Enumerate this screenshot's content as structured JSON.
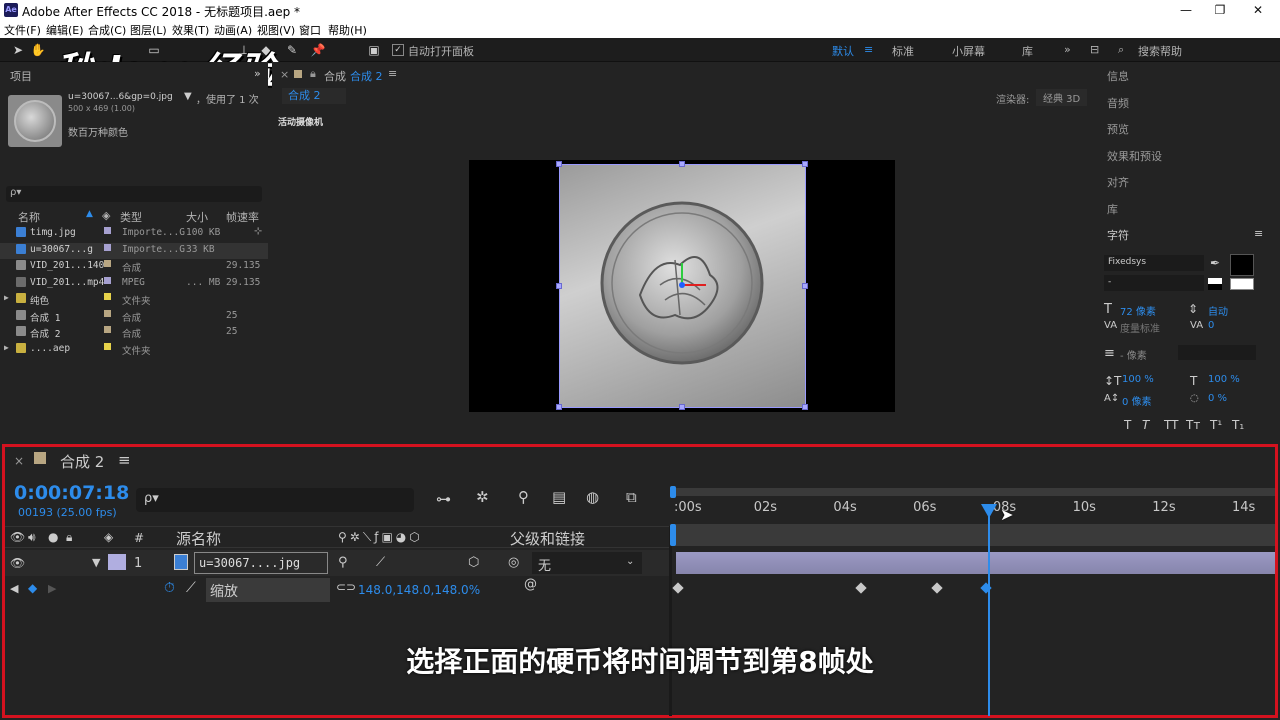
{
  "window": {
    "app_icon": "Ae",
    "title": "Adobe After Effects CC 2018 - 无标题项目.aep *",
    "controls": [
      "—",
      "❐",
      "✕"
    ]
  },
  "menu": [
    "文件(F)",
    "编辑(E)",
    "合成(C)",
    "图层(L)",
    "效果(T)",
    "动画(A)",
    "视图(V)",
    "窗口",
    "帮助(H)"
  ],
  "toolbar": {
    "auto_open_label": "自动打开面板",
    "workspaces": [
      "默认",
      "标准",
      "小屏幕",
      "库"
    ],
    "search_help": "搜索帮助"
  },
  "watermark": "秒dong经验",
  "project": {
    "tab": "项目",
    "selected_name": "u=30067...6&gp=0.jpg",
    "used_text": "，使用了 1 次",
    "dims": "500 x 469 (1.00)",
    "color_text": "数百万种颜色",
    "search_placeholder": "ρ▾",
    "headers": [
      "名称",
      "类型",
      "大小",
      "帧速率"
    ],
    "rows": [
      {
        "name": "timg.jpg",
        "type": "Importe...G",
        "size": "100 KB",
        "fps": "",
        "color": "#a6a0d0",
        "icon": "image"
      },
      {
        "name": "u=30067...g",
        "type": "Importe...G",
        "size": "33 KB",
        "fps": "",
        "color": "#a6a0d0",
        "icon": "image"
      },
      {
        "name": "VID_201...140",
        "type": "合成",
        "size": "",
        "fps": "29.135",
        "color": "#b8a682",
        "icon": "comp"
      },
      {
        "name": "VID_201...mp4",
        "type": "MPEG",
        "size": "... MB",
        "fps": "29.135",
        "color": "#a6a0d0",
        "icon": "video"
      },
      {
        "name": "纯色",
        "type": "文件夹",
        "size": "",
        "fps": "",
        "color": "#e6d24a",
        "icon": "folder"
      },
      {
        "name": "合成 1",
        "type": "合成",
        "size": "",
        "fps": "25",
        "color": "#b8a682",
        "icon": "comp"
      },
      {
        "name": "合成 2",
        "type": "合成",
        "size": "",
        "fps": "25",
        "color": "#b8a682",
        "icon": "comp"
      },
      {
        "name": "....aep",
        "type": "文件夹",
        "size": "",
        "fps": "",
        "color": "#e6d24a",
        "icon": "folder"
      }
    ]
  },
  "viewer": {
    "tab_prefix": "合成",
    "tab_name": "合成 2",
    "comp_chip": "合成 2",
    "renderer_label": "渲染器:",
    "renderer_value": "经典 3D",
    "camera_label": "活动摄像机"
  },
  "right_panel": {
    "items": [
      "信息",
      "音频",
      "预览",
      "效果和预设",
      "对齐",
      "库",
      "字符"
    ],
    "font_name": "Fixedsys",
    "font_style": "-",
    "font_size": "72 像素",
    "leading": "自动",
    "tracking_label": "度量标准",
    "tracking_value": "0",
    "stroke_width": "- 像素",
    "vscale": "100 %",
    "hscale": "100 %",
    "baseline": "0 像素",
    "tsume": "0 %",
    "format_buttons": [
      "T",
      "T",
      "TT",
      "Tт",
      "T¹",
      "T₁"
    ]
  },
  "timeline": {
    "tab": "合成 2",
    "timecode": "0:00:07:18",
    "frames": "00193 (25.00 fps)",
    "header_source": "源名称",
    "header_num": "#",
    "header_parent": "父级和链接",
    "layer": {
      "index": "1",
      "name": "u=30067....jpg",
      "parent": "无"
    },
    "property": {
      "name": "缩放",
      "value": "148.0,148.0,148.0%"
    },
    "ruler": [
      ":00s",
      "02s",
      "04s",
      "06s",
      "08s",
      "10s",
      "12s",
      "14s"
    ],
    "current_time_fraction": 0.525,
    "keyframes_seconds": [
      0,
      4.6,
      6.5,
      7.72
    ]
  },
  "subtitle": "选择正面的硬币将时间调节到第8帧处"
}
